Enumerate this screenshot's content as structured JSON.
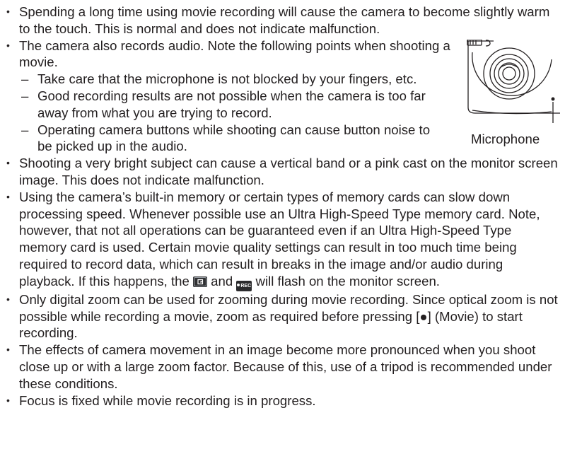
{
  "bullets": [
    {
      "text": "Spending a long time using movie recording will cause the camera to become slightly warm to the touch. This is normal and does not indicate malfunction."
    },
    {
      "text": "The camera also records audio. Note the following points when shooting a movie."
    },
    {
      "text": "Shooting a very bright subject can cause a vertical band or a pink cast on the monitor screen image. This does not indicate malfunction."
    },
    {
      "text_before_icons": "Using the camera’s built-in memory or certain types of memory cards can slow down processing speed. Whenever possible use an Ultra High-Speed Type memory card. Note, however, that not all operations can be guaranteed even if an Ultra High-Speed Type memory card is used. Certain movie quality settings can result in too much time being required to record data, which can result in breaks in the image and/or audio during playback. If this happens, the ",
      "text_between_icons": " and ",
      "text_after_icons": " will flash on the monitor screen.",
      "icon_1": "movie-mode-icon",
      "icon_2": "rec-icon",
      "icon_2_label": "REC"
    },
    {
      "text": "Only digital zoom can be used for zooming during movie recording. Since optical zoom is not possible while recording a movie, zoom as required before pressing [●] (Movie) to start recording."
    },
    {
      "text": "The effects of camera movement in an image become more pronounced when you shoot close up or with a large zoom factor. Because of this, use of a tripod is recommended under these conditions."
    },
    {
      "text": "Focus is fixed while movie recording is in progress."
    }
  ],
  "sub_points": [
    {
      "text": "Take care that the microphone is not blocked by your fingers, etc."
    },
    {
      "text": "Good recording results are not possible when the camera is too far away from what you are trying to record."
    },
    {
      "text": "Operating camera buttons while shooting can cause button noise to be picked up in the audio."
    }
  ],
  "figure": {
    "caption": "Microphone",
    "illustration": "camera-front-lens-illustration"
  }
}
